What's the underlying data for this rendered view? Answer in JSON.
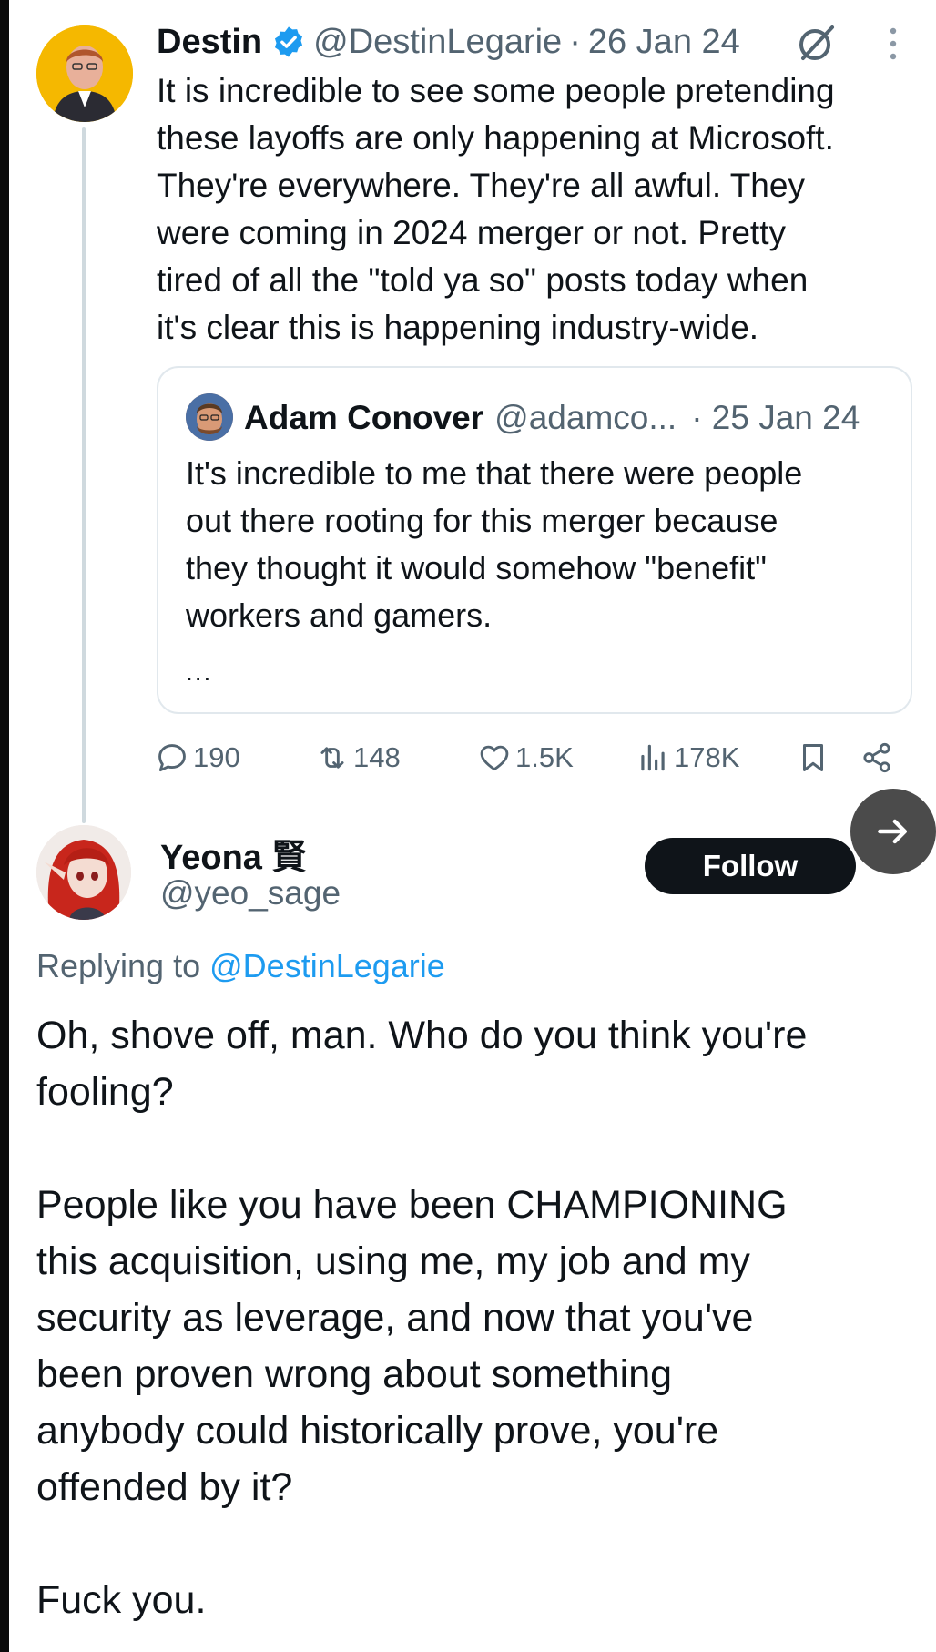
{
  "parent_tweet": {
    "author_name": "Destin",
    "handle": "@DestinLegarie",
    "separator": "·",
    "date": "26 Jan 24",
    "text": "It is incredible to see some people pretending\nthese layoffs are only happening at Microsoft.\nThey're everywhere. They're all awful. They\nwere coming in 2024 merger or not. Pretty\ntired of all the \"told ya so\" posts today when\nit's clear this is happening industry-wide.",
    "quote": {
      "author_name": "Adam Conover",
      "handle": "@adamco...",
      "date": "· 25 Jan 24",
      "text": "It's incredible to me that there were people\nout there rooting for this merger because\nthey thought it would somehow \"benefit\"\nworkers and gamers.",
      "more": "..."
    },
    "stats": {
      "replies": "190",
      "retweets": "148",
      "likes": "1.5K",
      "views": "178K"
    },
    "verified_color": "#1d9bf0"
  },
  "reply": {
    "author_name": "Yeona 賢",
    "handle": "@yeo_sage",
    "follow_label": "Follow",
    "replying_prefix": "Replying to",
    "replying_to": "@DestinLegarie",
    "text": "Oh, shove off, man. Who do you think you're\nfooling?\n\nPeople like you have been CHAMPIONING\nthis acquisition, using me, my job and my\nsecurity as leverage, and now that you've\nbeen proven wrong about something\nanybody could historically prove, you're\noffended by it?\n\nFuck you."
  },
  "colors": {
    "text_primary": "#0f1419",
    "text_secondary": "#536471",
    "link": "#1d9bf0",
    "follow_button_bg": "#0f1419"
  },
  "icons": [
    "verified-badge-icon",
    "grok-icon",
    "more-icon",
    "reply-icon",
    "retweet-icon",
    "like-icon",
    "views-icon",
    "bookmark-icon",
    "share-icon",
    "arrow-right-icon"
  ]
}
